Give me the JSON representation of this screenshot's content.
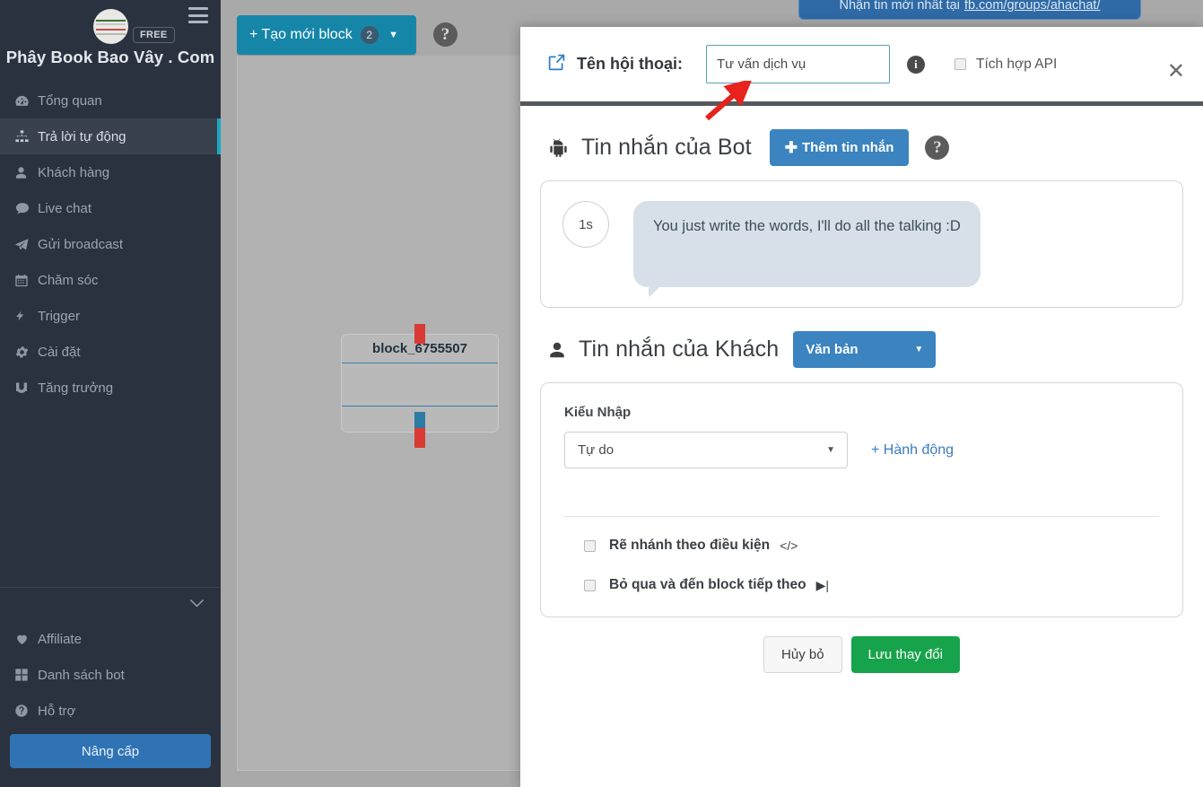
{
  "sidebar": {
    "brand": "Phây Book Bao Vây . Com",
    "plan_badge": "FREE",
    "items": [
      {
        "label": "Tổng quan",
        "icon": "dashboard-icon"
      },
      {
        "label": "Trả lời tự động",
        "icon": "sitemap-icon"
      },
      {
        "label": "Khách hàng",
        "icon": "user-icon"
      },
      {
        "label": "Live chat",
        "icon": "comment-icon"
      },
      {
        "label": "Gửi broadcast",
        "icon": "paper-plane-icon"
      },
      {
        "label": "Chăm sóc",
        "icon": "calendar-icon"
      },
      {
        "label": "Trigger",
        "icon": "bolt-icon"
      },
      {
        "label": "Cài đặt",
        "icon": "gear-icon"
      },
      {
        "label": "Tăng trưởng",
        "icon": "magnet-icon"
      }
    ],
    "bottom_items": [
      {
        "label": "Affiliate",
        "icon": "heart-icon"
      },
      {
        "label": "Danh sách bot",
        "icon": "grid-icon"
      },
      {
        "label": "Hỗ trợ",
        "icon": "question-circle-icon"
      }
    ],
    "upgrade_label": "Nâng cấp"
  },
  "topbar": {
    "new_block_label": "+ Tạo mới block",
    "new_block_count": "2",
    "help_label": "?"
  },
  "banner": {
    "text": "Nhận tin mới nhất tại",
    "link": "fb.com/groups/ahachat/"
  },
  "canvas": {
    "node_title": "block_6755507"
  },
  "modal": {
    "header": {
      "label": "Tên hội thoại:",
      "input_value": "Tư vấn dịch vụ",
      "input_placeholder": "",
      "info_label": "i",
      "api_checkbox_label": "Tích hợp API",
      "api_checked": false,
      "close_label": "✕"
    },
    "bot_section": {
      "title": "Tin nhắn của Bot",
      "add_button_label": "Thêm tin nhắn",
      "help_label": "?",
      "message": {
        "delay": "1s",
        "text": "You just write the words, I'll do all the talking :D"
      }
    },
    "guest_section": {
      "title": "Tin nhắn của Khách",
      "type_dropdown_value": "Văn bản",
      "input_style_label": "Kiểu Nhập",
      "input_style_value": "Tự do",
      "action_link_label": "+ Hành động",
      "checkboxes": [
        {
          "label": "Rẽ nhánh theo điều kiện",
          "glyph": "</>",
          "checked": false
        },
        {
          "label": "Bỏ qua và đến block tiếp theo",
          "glyph": "▶|",
          "checked": false
        }
      ]
    },
    "footer": {
      "cancel_label": "Hủy bỏ",
      "save_label": "Lưu thay đổi"
    }
  },
  "colors": {
    "sidebar_bg": "#2b323f",
    "accent_teal": "#1686a8",
    "accent_blue": "#3b84c0",
    "save_green": "#17a34b",
    "annotation_red": "#e8221c"
  }
}
